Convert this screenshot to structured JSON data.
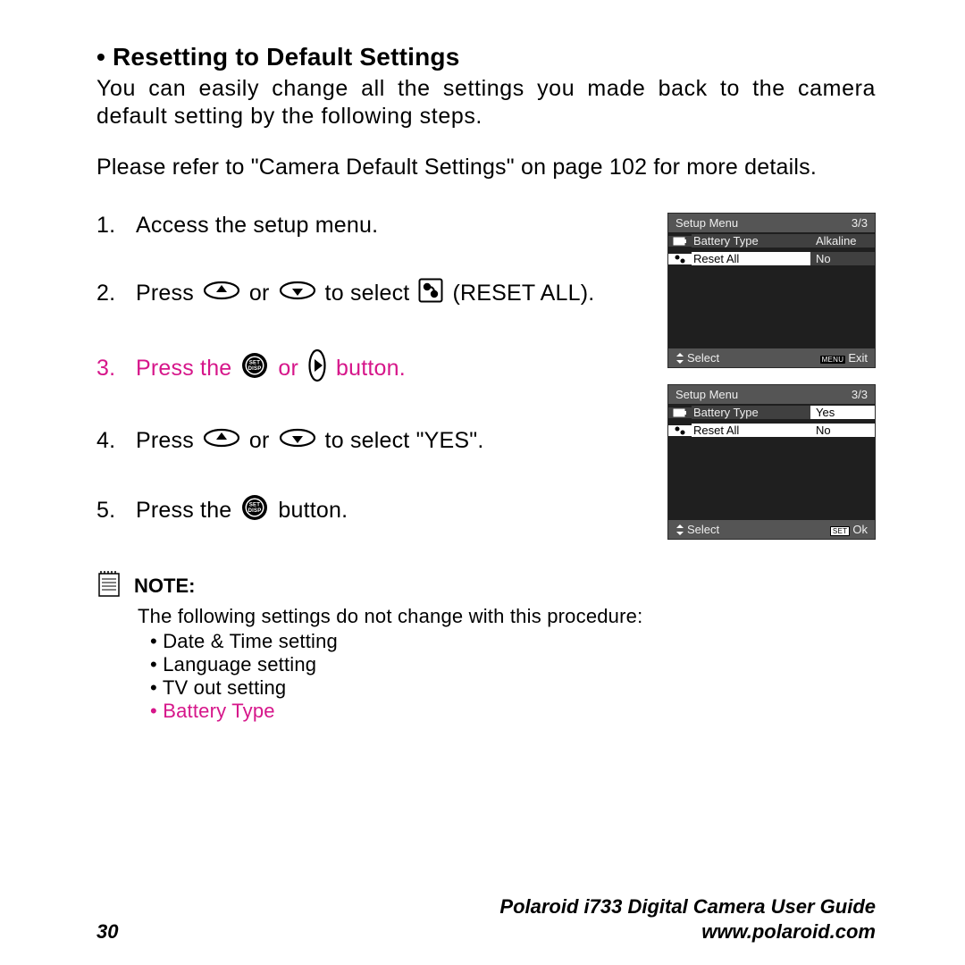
{
  "heading": "Resetting to Default Settings",
  "intro": "You can easily change all the settings you made back to the camera default setting by the following steps.",
  "refer": "Please refer to \"Camera Default Settings\" on page 102 for more details.",
  "steps": {
    "s1": {
      "num": "1.",
      "text": "Access the setup menu."
    },
    "s2": {
      "num": "2.",
      "a": "Press",
      "b": "or",
      "c": "to select",
      "d": "(RESET ALL)."
    },
    "s3": {
      "num": "3.",
      "a": "Press the",
      "b": "or",
      "c": "button."
    },
    "s4": {
      "num": "4.",
      "a": "Press",
      "b": "or",
      "c": "to select \"YES\"."
    },
    "s5": {
      "num": "5.",
      "a": "Press the",
      "b": "button."
    }
  },
  "screen1": {
    "title": "Setup Menu",
    "page": "3/3",
    "r1_label": "Battery Type",
    "r1_value": "Alkaline",
    "r2_label": "Reset All",
    "r2_value": "No",
    "fl": "Select",
    "fr": "Exit",
    "fr_badge": "MENU"
  },
  "screen2": {
    "title": "Setup Menu",
    "page": "3/3",
    "r1_label": "Battery Type",
    "r1_value": "Yes",
    "r2_label": "Reset All",
    "r2_value": "No",
    "fl": "Select",
    "fr": "Ok",
    "fr_badge": "SET"
  },
  "note": {
    "title": "NOTE:",
    "text": "The following settings do not change with this procedure:",
    "li1": "Date & Time setting",
    "li2": "Language setting",
    "li3": "TV out setting",
    "li4": "Battery Type"
  },
  "footer": {
    "page": "30",
    "title": "Polaroid i733 Digital Camera User Guide",
    "url": "www.polaroid.com"
  }
}
